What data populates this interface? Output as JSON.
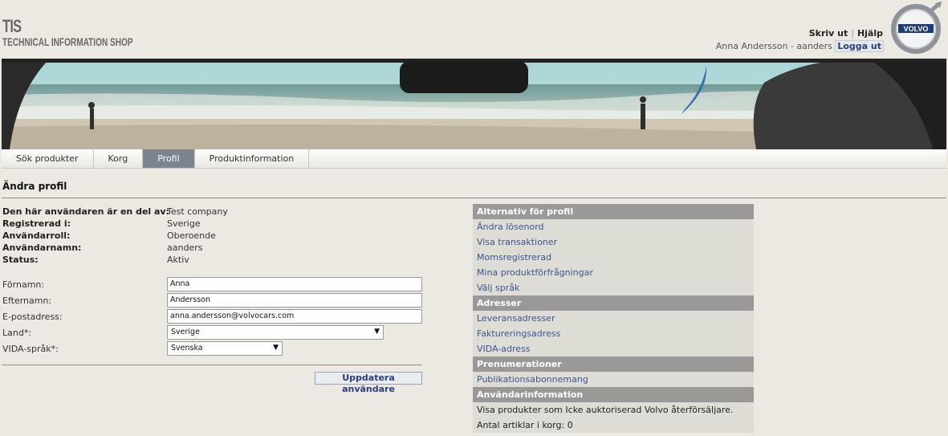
{
  "brand": {
    "short": "TIS",
    "full": "TECHNICAL INFORMATION SHOP",
    "logo_text": "VOLVO"
  },
  "top": {
    "logout_link": "Skriv ut",
    "help_link": "Hjälp",
    "user": "Anna Andersson - aanders",
    "logout": "Logga ut"
  },
  "tabs": [
    {
      "label": "Sök produkter"
    },
    {
      "label": "Korg"
    },
    {
      "label": "Profil",
      "active": true
    },
    {
      "label": "Produktinformation"
    }
  ],
  "page": {
    "title": "Ändra profil"
  },
  "info": [
    {
      "label": "Den här användaren är en del av:",
      "value": "Test company"
    },
    {
      "label": "Registrerad i:",
      "value": "Sverige"
    },
    {
      "label": "Användarroll:",
      "value": "Oberoende"
    },
    {
      "label": "Användarnamn:",
      "value": "aanders"
    },
    {
      "label": "Status:",
      "value": "Aktiv"
    }
  ],
  "form": {
    "firstname_label": "Förnamn:",
    "firstname": "Anna",
    "lastname_label": "Efternamn:",
    "lastname": "Andersson",
    "email_label": "E-postadress:",
    "email": "anna.andersson@volvocars.com",
    "country_label": "Land*:",
    "country": "Sverige",
    "lang_label": "VIDA-språk*:",
    "lang": "Svenska",
    "update_button": "Uppdatera användare"
  },
  "side": {
    "profile_header": "Alternativ för profil",
    "profile_links": [
      "Ändra lösenord",
      "Visa transaktioner",
      "Momsregistrerad",
      "Mina produktförfrågningar",
      "Välj språk"
    ],
    "address_header": "Adresser",
    "address_links": [
      "Leveransadresser",
      "Faktureringsadress",
      "VIDA-adress"
    ],
    "subs_header": "Prenumerationer",
    "subs_links": [
      "Publikationsabonnemang"
    ],
    "userinfo_header": "Användarinformation",
    "userinfo_lines": [
      "Visa produkter som Icke auktoriserad Volvo återförsäljare.",
      "Antal artiklar i korg: 0"
    ]
  },
  "colors": {
    "tab_active": "#7b8590",
    "side_header": "#9a9997",
    "link": "#3c5590",
    "background": "#ebe9e2"
  }
}
